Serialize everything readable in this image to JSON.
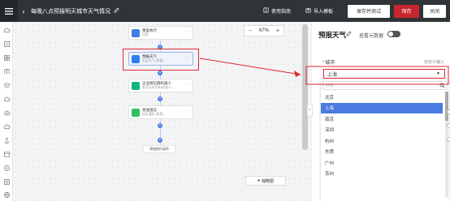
{
  "header": {
    "title": "每晚八点预报明天城市天气情况",
    "use_guide": "使用指南",
    "import_template": "导入模板",
    "save_and_test": "保存并测试",
    "save": "保存",
    "close": "关闭"
  },
  "canvas": {
    "zoom_level": "67%",
    "zoom_out": "−",
    "zoom_in": "+",
    "nodes": [
      {
        "title": "重复执行",
        "subtitle": "日程",
        "more": "···"
      },
      {
        "title": "预报天气",
        "subtitle": "彩云天气 (帮我)",
        "more": "···"
      },
      {
        "title": "企业微信群机器人",
        "subtitle": "发送文本消息(机器人)",
        "more": "···"
      },
      {
        "title": "发送短信",
        "subtitle": "短信通知 (帮我)",
        "more": "···"
      }
    ],
    "end_action": "添加执行动作",
    "minimap": "缩略图"
  },
  "panel": {
    "title": "预报天气",
    "view_meta": "查看元数据",
    "city_label": "城市",
    "required_mark": "*",
    "custom_input": "自定义输入",
    "selected_city": "上海",
    "search_placeholder": "搜索",
    "cities": [
      "北京",
      "上海",
      "南京",
      "深圳",
      "杭州",
      "东莞",
      "广州",
      "苏州"
    ]
  },
  "colors": {
    "topbar": "#2f3437",
    "accent_red": "#c6262e",
    "highlight_red": "#e0262f",
    "select_blue": "#4a7be0"
  }
}
